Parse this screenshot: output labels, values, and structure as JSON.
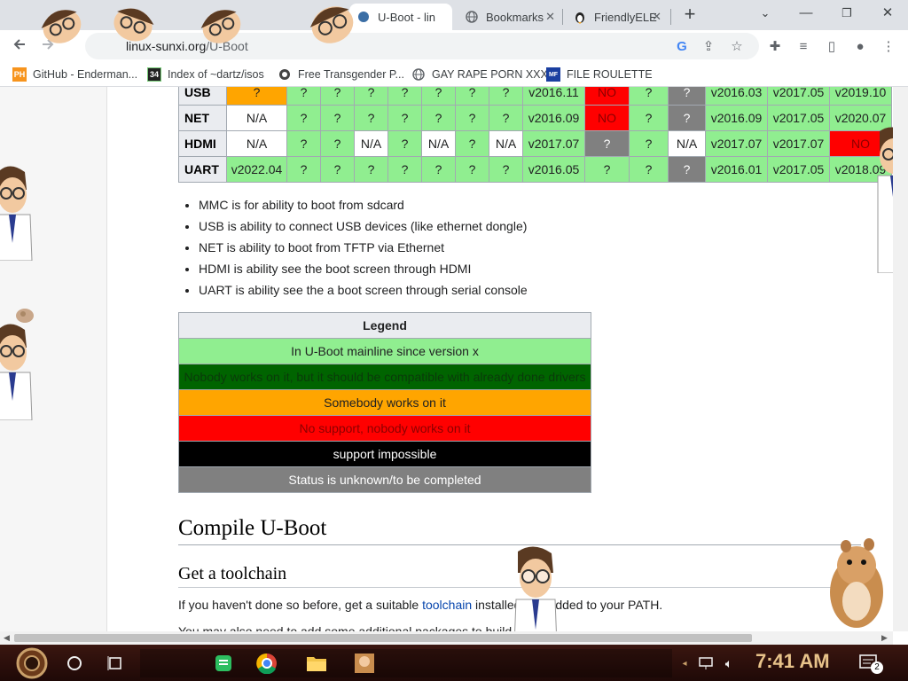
{
  "tabs": [
    {
      "title": "U-Boot - lin",
      "icon": "linux-sunxi-icon",
      "active": true
    },
    {
      "title": "Bookmarks",
      "icon": "globe-icon",
      "active": false
    },
    {
      "title": "FriendlyELE",
      "icon": "linux-penguin-icon",
      "active": false
    }
  ],
  "toolbar": {
    "url_host": "linux-sunxi.org",
    "url_path": "/U-Boot"
  },
  "bookmarks": [
    {
      "label": "GitHub - Enderman...",
      "icon_text": "PH"
    },
    {
      "label": "Index of ~dartz/isos",
      "icon_text": "34"
    },
    {
      "label": "Free Transgender P...",
      "icon_text": ""
    },
    {
      "label": "GAY RAPE PORN XXX",
      "icon_text": ""
    },
    {
      "label": "FILE ROULETTE",
      "icon_text": "MF"
    }
  ],
  "status_table": {
    "rows": [
      {
        "name": "USB",
        "cells": [
          {
            "t": "?",
            "c": "o"
          },
          {
            "t": "?",
            "c": "g"
          },
          {
            "t": "?",
            "c": "g"
          },
          {
            "t": "?",
            "c": "g"
          },
          {
            "t": "?",
            "c": "g"
          },
          {
            "t": "?",
            "c": "g"
          },
          {
            "t": "?",
            "c": "g"
          },
          {
            "t": "?",
            "c": "g"
          },
          {
            "t": "v2016.11",
            "c": "g"
          },
          {
            "t": "NO",
            "c": "r"
          },
          {
            "t": "?",
            "c": "g"
          },
          {
            "t": "?",
            "c": "u"
          },
          {
            "t": "v2016.03",
            "c": "g"
          },
          {
            "t": "v2017.05",
            "c": "g"
          },
          {
            "t": "v2019.10",
            "c": "g"
          }
        ]
      },
      {
        "name": "NET",
        "cells": [
          {
            "t": "N/A",
            "c": "w"
          },
          {
            "t": "?",
            "c": "g"
          },
          {
            "t": "?",
            "c": "g"
          },
          {
            "t": "?",
            "c": "g"
          },
          {
            "t": "?",
            "c": "g"
          },
          {
            "t": "?",
            "c": "g"
          },
          {
            "t": "?",
            "c": "g"
          },
          {
            "t": "?",
            "c": "g"
          },
          {
            "t": "v2016.09",
            "c": "g"
          },
          {
            "t": "NO",
            "c": "r"
          },
          {
            "t": "?",
            "c": "g"
          },
          {
            "t": "?",
            "c": "u"
          },
          {
            "t": "v2016.09",
            "c": "g"
          },
          {
            "t": "v2017.05",
            "c": "g"
          },
          {
            "t": "v2020.07",
            "c": "g"
          }
        ]
      },
      {
        "name": "HDMI",
        "cells": [
          {
            "t": "N/A",
            "c": "w"
          },
          {
            "t": "?",
            "c": "g"
          },
          {
            "t": "?",
            "c": "g"
          },
          {
            "t": "N/A",
            "c": "w"
          },
          {
            "t": "?",
            "c": "g"
          },
          {
            "t": "N/A",
            "c": "w"
          },
          {
            "t": "?",
            "c": "g"
          },
          {
            "t": "N/A",
            "c": "w"
          },
          {
            "t": "v2017.07",
            "c": "g"
          },
          {
            "t": "?",
            "c": "u"
          },
          {
            "t": "?",
            "c": "g"
          },
          {
            "t": "N/A",
            "c": "w"
          },
          {
            "t": "v2017.07",
            "c": "g"
          },
          {
            "t": "v2017.07",
            "c": "g"
          },
          {
            "t": "NO",
            "c": "r"
          }
        ]
      },
      {
        "name": "UART",
        "cells": [
          {
            "t": "v2022.04",
            "c": "g"
          },
          {
            "t": "?",
            "c": "g"
          },
          {
            "t": "?",
            "c": "g"
          },
          {
            "t": "?",
            "c": "g"
          },
          {
            "t": "?",
            "c": "g"
          },
          {
            "t": "?",
            "c": "g"
          },
          {
            "t": "?",
            "c": "g"
          },
          {
            "t": "?",
            "c": "g"
          },
          {
            "t": "v2016.05",
            "c": "g"
          },
          {
            "t": "?",
            "c": "g"
          },
          {
            "t": "?",
            "c": "g"
          },
          {
            "t": "?",
            "c": "u"
          },
          {
            "t": "v2016.01",
            "c": "g"
          },
          {
            "t": "v2017.05",
            "c": "g"
          },
          {
            "t": "v2018.09",
            "c": "g"
          }
        ]
      }
    ]
  },
  "notes": [
    "MMC is for ability to boot from sdcard",
    "USB is ability to connect USB devices (like ethernet dongle)",
    "NET is ability to boot from TFTP via Ethernet",
    "HDMI is ability see the boot screen through HDMI",
    "UART is ability see the a boot screen through serial console"
  ],
  "legend": {
    "title": "Legend",
    "rows": [
      {
        "text": "In U-Boot mainline since version x",
        "c": "lg"
      },
      {
        "text": "Nobody works on it, but it should be compatible with already done drivers",
        "c": "ldg"
      },
      {
        "text": "Somebody works on it",
        "c": "lo"
      },
      {
        "text": "No support, nobody works on it",
        "c": "lr"
      },
      {
        "text": "support impossible",
        "c": "lb"
      },
      {
        "text": "Status is unknown/to be completed",
        "c": "lu"
      }
    ]
  },
  "sections": {
    "compile_heading": "Compile U-Boot",
    "toolchain_heading": "Get a toolchain",
    "para1_before": "If you haven't done so before, get a suitable ",
    "para1_link": "toolchain",
    "para1_after": " installed and added to your PATH.",
    "para2": "You may also need to add some additional packages to build U-Boot:"
  },
  "taskbar": {
    "clock": "7:41 AM",
    "notification_count": "2"
  },
  "colors": {
    "green": "#90ee90",
    "red": "#ff0000",
    "orange": "#ffa500",
    "gray": "#808080",
    "dark_green": "#006400",
    "link": "#0645ad"
  }
}
